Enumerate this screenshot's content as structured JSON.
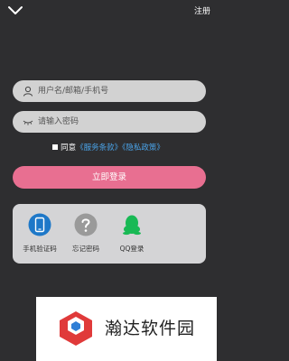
{
  "header": {
    "back_icon": "chevron-down-icon",
    "register_label": "注册"
  },
  "login_form": {
    "username_placeholder": "用户名/邮箱/手机号",
    "password_placeholder": "请输入密码",
    "username_icon": "user-icon",
    "password_icon": "eye-closed-icon",
    "agree_prefix": "同意",
    "terms_link": "《服务条款》",
    "privacy_link": "《隐私政策》",
    "login_button": "立即登录"
  },
  "alt_login": [
    {
      "label": "手机验证码",
      "icon": "phone-icon"
    },
    {
      "label": "忘记密码",
      "icon": "question-icon"
    },
    {
      "label": "QQ登录",
      "icon": "qq-penguin-icon"
    }
  ],
  "watermark": {
    "text": "瀚达软件园"
  },
  "colors": {
    "background": "#2e2e30",
    "accent_pink": "#e86f91",
    "link_blue": "#4aa3e8",
    "field_gray": "#d2d2d2",
    "qq_green": "#19b955"
  }
}
